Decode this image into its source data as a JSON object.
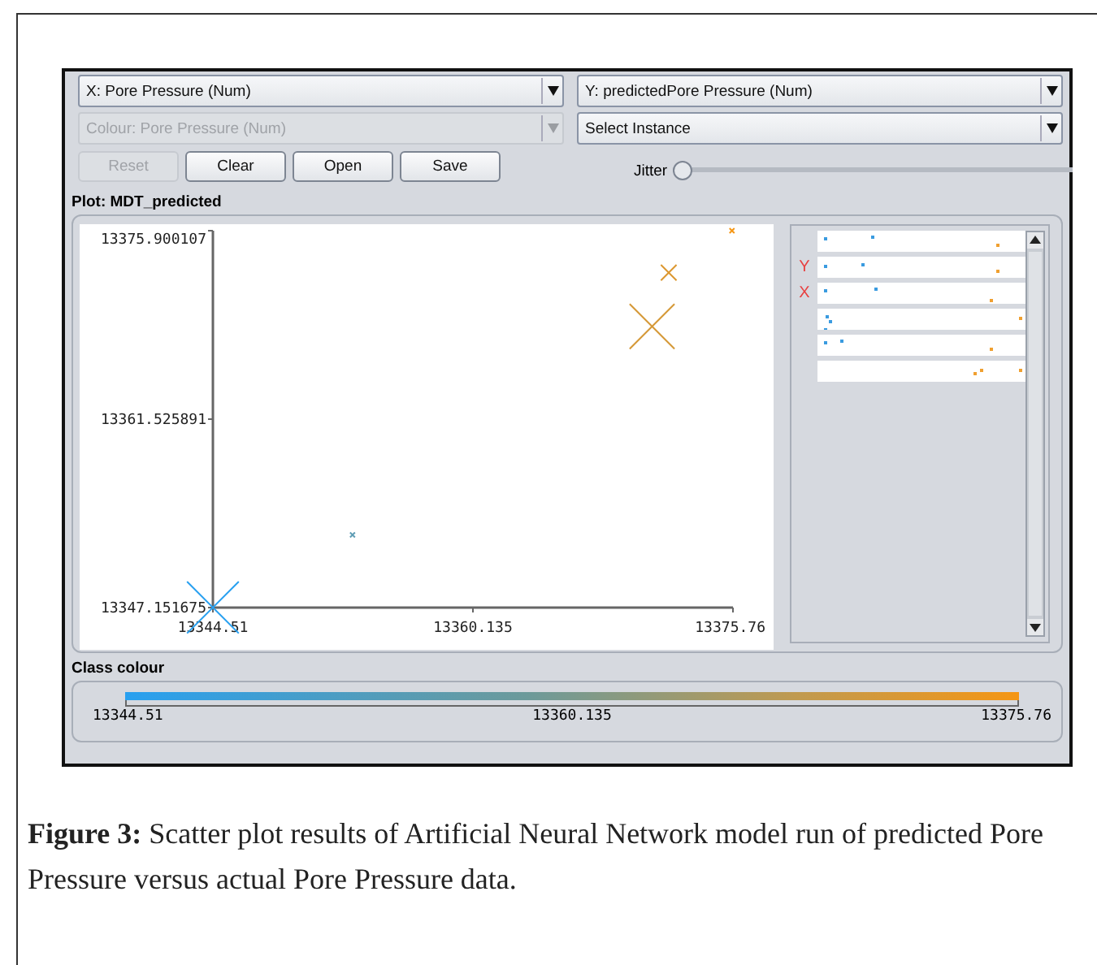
{
  "controls": {
    "x_select": {
      "value": "X: Pore Pressure (Num)",
      "disabled": false
    },
    "y_select": {
      "value": "Y: predictedPore Pressure (Num)",
      "disabled": false
    },
    "colour_select": {
      "value": "Colour: Pore Pressure (Num)",
      "disabled": true
    },
    "instance_select": {
      "value": "Select Instance",
      "disabled": false
    },
    "buttons": [
      {
        "label": "Reset",
        "disabled": true
      },
      {
        "label": "Clear",
        "disabled": false
      },
      {
        "label": "Open",
        "disabled": false
      },
      {
        "label": "Save",
        "disabled": false
      }
    ],
    "jitter": {
      "label": "Jitter",
      "level": 0
    }
  },
  "plot": {
    "title": "Plot: MDT_predicted",
    "chart_data": {
      "type": "scatter",
      "x": [
        13344.51,
        13352.9,
        13370.9,
        13371.9,
        13375.7
      ],
      "values": [
        13347.16,
        13352.7,
        13368.6,
        13372.7,
        13375.9
      ],
      "xlim": [
        13344.51,
        13375.76
      ],
      "ylim": [
        13347.151675,
        13375.900107
      ],
      "xticks": [
        {
          "value": 13344.51,
          "label": "13344.51"
        },
        {
          "value": 13360.135,
          "label": "13360.135"
        },
        {
          "value": 13375.76,
          "label": "13375.76"
        }
      ],
      "yticks": [
        {
          "value": 13347.151675,
          "label": "13347.151675"
        },
        {
          "value": 13361.525891,
          "label": "13361.525891"
        },
        {
          "value": 13375.900107,
          "label": "13375.900107"
        }
      ]
    },
    "matrix_markers": [
      "Y",
      "X"
    ]
  },
  "class_colour": {
    "title": "Class colour",
    "ticks": [
      "13344.51",
      "13360.135",
      "13375.76"
    ]
  },
  "caption": "**Figure 3:** Scatter plot results of Artificial Neural Network model run of predicted Pore Pressure versus actual Pore Pressure data."
}
